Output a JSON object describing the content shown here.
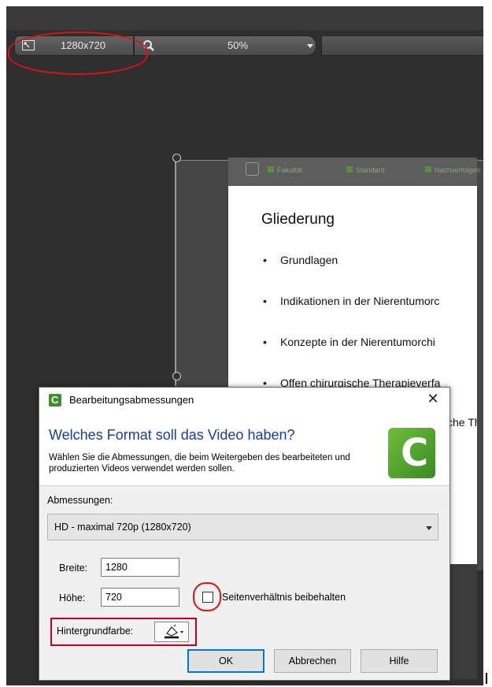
{
  "toolbar": {
    "dimensions_label": "1280x720",
    "zoom_value": "50%"
  },
  "slide": {
    "ribbon_items": [
      "Fakultät",
      "Standard",
      "Nachverfolgen"
    ],
    "title": "Gliederung",
    "bullets": [
      "Grundlagen",
      "Indikationen in der Nierentumorc",
      "Konzepte in der Nierentumorchi",
      "Offen chirurgische Therapieverfa",
      "che Th"
    ],
    "bullet_marker": "•"
  },
  "dialog": {
    "title": "Bearbeitungsabmessungen",
    "close": "✕",
    "heading": "Welches Format soll das Video haben?",
    "description": "Wählen Sie die Abmessungen, die beim Weitergeben des bearbeiteten und produzierten Videos verwendet werden sollen.",
    "dimensions_label": "Abmessungen:",
    "dimensions_value": "HD - maximal 720p (1280x720)",
    "width_label": "Breite:",
    "width_value": "1280",
    "height_label": "Höhe:",
    "height_value": "720",
    "keep_ratio_label": "Seitenverhältnis beibehalten",
    "keep_ratio_checked": false,
    "bg_color_label": "Hintergrundfarbe:",
    "ok": "OK",
    "cancel": "Abbrechen",
    "help": "Hilfe"
  },
  "colors": {
    "editor_bg": "#2f2f2f",
    "annotation_red": "#d11111",
    "heading_blue": "#1a3c9c",
    "logo_green": "#4fa52f"
  }
}
